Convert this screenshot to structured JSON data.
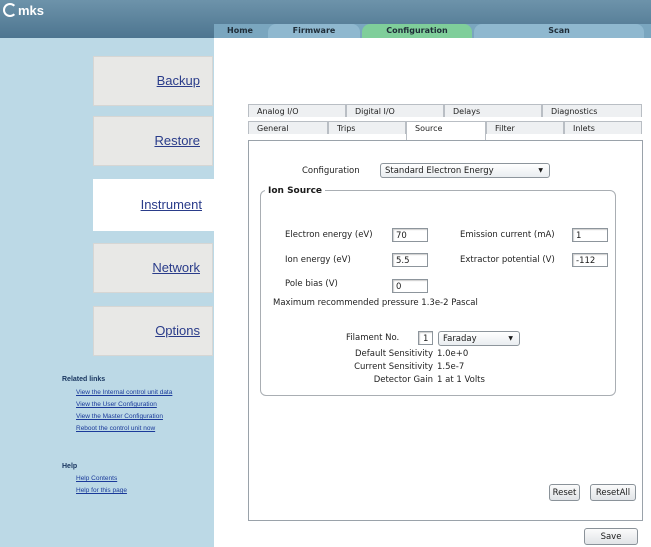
{
  "logo": "mks",
  "nav": {
    "tabs": [
      "Home",
      "Firmware",
      "Configuration",
      "Scan"
    ]
  },
  "sidebar": {
    "buttons": [
      "Backup",
      "Restore",
      "Instrument",
      "Network",
      "Options"
    ],
    "related_heading": "Related links",
    "related_links": [
      "View the Internal control unit data",
      "View the User Configuration",
      "View the Master Configuration",
      "Reboot the control unit now"
    ],
    "help_heading": "Help",
    "help_links": [
      "Help Contents",
      "Help for this page"
    ]
  },
  "tabs_row1": [
    "Analog I/O",
    "Digital I/O",
    "Delays",
    "Diagnostics"
  ],
  "tabs_row2": [
    "General",
    "Trips",
    "Source",
    "Filter",
    "Inlets"
  ],
  "form": {
    "configuration_label": "Configuration",
    "configuration_value": "Standard Electron Energy",
    "group_title": "Ion Source",
    "electron_energy_label": "Electron energy (eV)",
    "electron_energy_value": "70",
    "emission_current_label": "Emission current (mA)",
    "emission_current_value": "1",
    "ion_energy_label": "Ion energy (eV)",
    "ion_energy_value": "5.5",
    "extractor_potential_label": "Extractor potential (V)",
    "extractor_potential_value": "-112",
    "pole_bias_label": "Pole bias (V)",
    "pole_bias_value": "0",
    "max_pressure_text": "Maximum recommended pressure 1.3e-2  Pascal",
    "filament_label": "Filament No.",
    "filament_value": "1",
    "detector_value": "Faraday",
    "default_sensitivity_label": "Default Sensitivity",
    "default_sensitivity_value": "1.0e+0",
    "current_sensitivity_label": "Current Sensitivity",
    "current_sensitivity_value": "1.5e-7",
    "detector_gain_label": "Detector Gain",
    "detector_gain_value": "1 at 1 Volts"
  },
  "buttons": {
    "reset": "Reset",
    "reset_all": "ResetAll",
    "save": "Save"
  },
  "icons": {
    "dropdown": "chevron-down-icon"
  },
  "colors": {
    "sidebar_bg": "#bcd9e6",
    "active_tab": "#7fce9a",
    "header": "#5a819a"
  }
}
